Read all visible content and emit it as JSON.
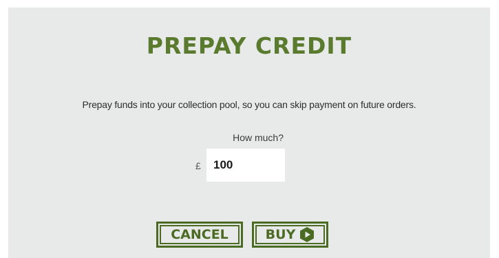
{
  "dialog": {
    "title": "PREPAY CREDIT",
    "description": "Prepay funds into your collection pool, so you can skip payment on future orders.",
    "amount_label": "How much?",
    "currency_symbol": "£",
    "amount_value": "100",
    "cancel_label": "CANCEL",
    "buy_label": "BUY",
    "buy_icon": "hexagon-play-icon"
  },
  "colors": {
    "background": "#e8e9e9",
    "brand_green": "#5a7a2e",
    "button_green": "#4b6a22"
  }
}
